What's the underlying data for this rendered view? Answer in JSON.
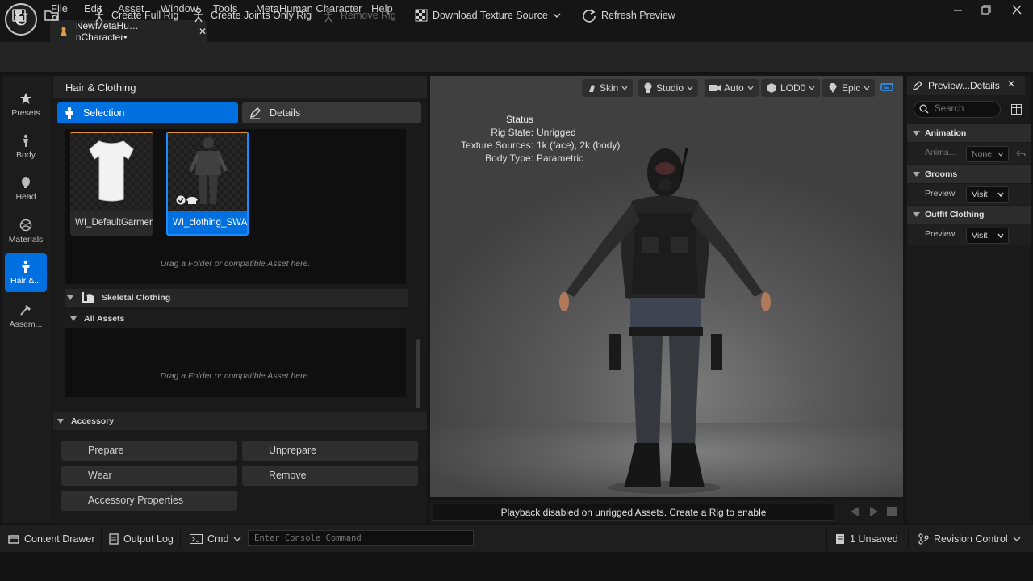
{
  "app": {
    "logo_letter": "U",
    "menu": [
      "File",
      "Edit",
      "Asset",
      "Window",
      "Tools",
      "MetaHuman Character",
      "Help"
    ],
    "document_tab": "NewMetaHu…nCharacter•",
    "window_controls": {
      "close_glyph": "✕"
    }
  },
  "toolbar": {
    "create_full_rig": "Create Full Rig",
    "create_joints_only_rig": "Create Joints Only Rig",
    "remove_rig": "Remove Rig",
    "download_texture_source": "Download Texture Source",
    "refresh_preview": "Refresh Preview"
  },
  "rail": {
    "items": [
      {
        "label": "Presets",
        "icon": "star-icon"
      },
      {
        "label": "Body",
        "icon": "body-icon"
      },
      {
        "label": "Head",
        "icon": "head-icon"
      },
      {
        "label": "Materials",
        "icon": "materials-icon"
      },
      {
        "label": "Hair &...",
        "icon": "hair-clothing-icon",
        "active": true
      },
      {
        "label": "Assem...",
        "icon": "hammer-icon"
      }
    ]
  },
  "hair_clothing": {
    "title": "Hair & Clothing",
    "tabs": {
      "selection": "Selection",
      "details": "Details"
    },
    "assets": [
      {
        "label": "WI_DefaultGarment",
        "selected": false
      },
      {
        "label": "WI_clothing_SWA...",
        "selected": true
      }
    ],
    "drop_hint": "Drag a Folder or compatible Asset here.",
    "skeletal_clothing": {
      "title": "Skeletal Clothing",
      "all_assets": "All Assets",
      "drop_hint": "Drag a Folder or compatible Asset here."
    },
    "accessory": {
      "title": "Accessory",
      "prepare": "Prepare",
      "unprepare": "Unprepare",
      "wear": "Wear",
      "remove": "Remove",
      "properties": "Accessory Properties"
    }
  },
  "viewport": {
    "buttons": {
      "skin": "Skin",
      "studio": "Studio",
      "auto": "Auto",
      "lod": "LOD0",
      "quality": "Epic"
    },
    "status": {
      "title": "Status",
      "rows": [
        {
          "label": "Rig State:",
          "value": "Unrigged"
        },
        {
          "label": "Texture Sources:",
          "value": "1k (face), 2k (body)"
        },
        {
          "label": "Body Type:",
          "value": "Parametric"
        }
      ]
    },
    "playback_message": "Playback disabled on unrigged Assets. Create a Rig to enable"
  },
  "details_panel": {
    "tab": "Preview...Details",
    "search_placeholder": "Search",
    "sections": [
      {
        "title": "Animation",
        "row_label": "Anima...",
        "value": "None"
      },
      {
        "title": "Grooms",
        "row_label": "Preview",
        "value": "Visit"
      },
      {
        "title": "Outfit Clothing",
        "row_label": "Preview",
        "value": "Visit"
      }
    ]
  },
  "status_bar": {
    "content_drawer": "Content Drawer",
    "output_log": "Output Log",
    "cmd": "Cmd",
    "console_placeholder": "Enter Console Command",
    "unsaved": "1 Unsaved",
    "revision_control": "Revision Control"
  },
  "colors": {
    "accent": "#0070e0",
    "background": "#151515",
    "panel": "#1a1a1a"
  }
}
